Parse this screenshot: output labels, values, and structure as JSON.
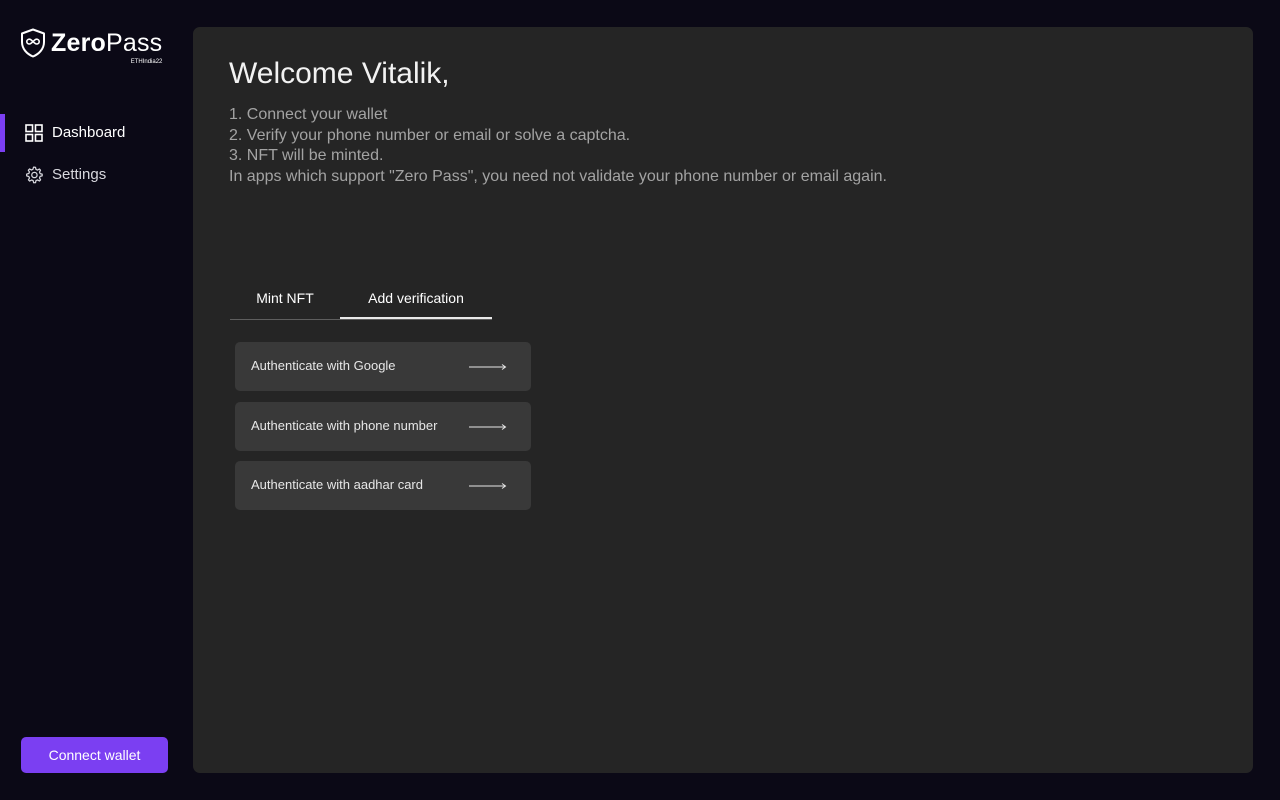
{
  "brand": {
    "name_part1": "Zero",
    "name_part2": "Pass",
    "subtitle": "ETHIndia22",
    "icon": "shield-infinity-icon"
  },
  "sidebar": {
    "items": [
      {
        "label": "Dashboard",
        "icon": "grid-icon",
        "active": true
      },
      {
        "label": "Settings",
        "icon": "gear-icon",
        "active": false
      }
    ],
    "connect_wallet_label": "Connect wallet"
  },
  "main": {
    "welcome": "Welcome Vitalik,",
    "instructions": [
      "1. Connect your wallet",
      "2. Verify your phone number or email or solve a captcha.",
      "3. NFT will be minted.",
      "In apps which support \"Zero Pass\", you need not validate your phone number or email again."
    ],
    "tabs": [
      {
        "label": "Mint NFT",
        "active": false
      },
      {
        "label": "Add verification",
        "active": true
      }
    ],
    "auth_options": [
      {
        "label": "Authenticate with Google",
        "icon": "arrow-right-icon"
      },
      {
        "label": "Authenticate with phone number",
        "icon": "arrow-right-icon"
      },
      {
        "label": "Authenticate with aadhar card",
        "icon": "arrow-right-icon"
      }
    ]
  },
  "colors": {
    "background": "#0b0916",
    "panel": "#252525",
    "accent": "#7b3ff2",
    "button": "#393939",
    "muted_text": "#a3a3a3"
  }
}
